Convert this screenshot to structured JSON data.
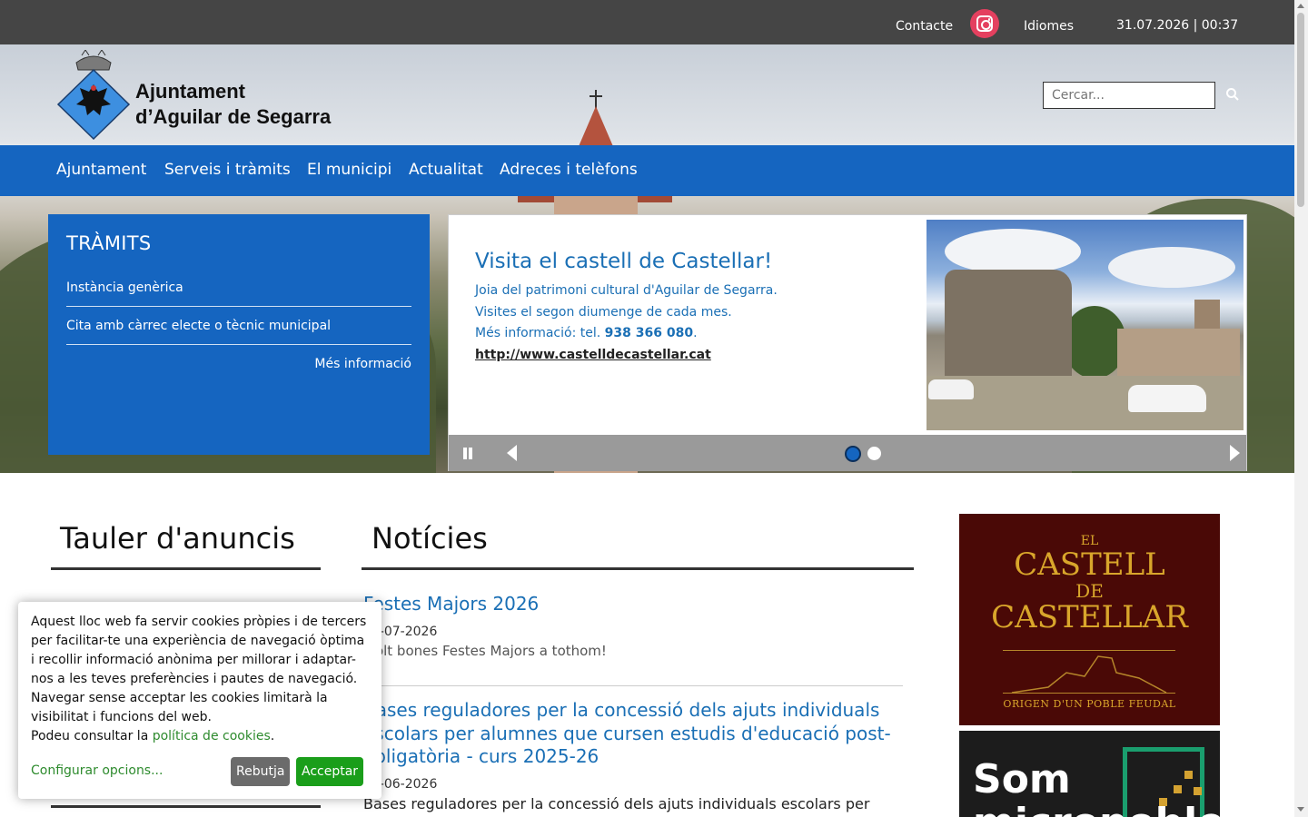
{
  "topbar": {
    "contact_label": "Contacte",
    "instagram_icon": "instagram-icon",
    "languages_label": "Idiomes",
    "datetime": "31.07.2026 | 00:37"
  },
  "header": {
    "logo_icon": "coat-of-arms-icon",
    "site_name_line1": "Ajuntament",
    "site_name_line2": "d’Aguilar de Segarra",
    "search_placeholder": "Cercar...",
    "search_icon": "search-icon"
  },
  "nav": {
    "items": [
      {
        "label": "Ajuntament"
      },
      {
        "label": "Serveis i tràmits"
      },
      {
        "label": "El municipi"
      },
      {
        "label": "Actualitat"
      },
      {
        "label": "Adreces i telèfons"
      }
    ]
  },
  "tramits": {
    "title": "TRÀMITS",
    "items": [
      {
        "label": "Instància genèrica"
      },
      {
        "label": "Cita amb càrrec electe o tècnic municipal"
      }
    ],
    "more_label": "Més informació"
  },
  "slider": {
    "title": "Visita el castell de Castellar!",
    "line1": "Joia del patrimoni cultural d'Aguilar de Segarra.",
    "line2": "Visites el segon diumenge de cada mes.",
    "line3_prefix": "Més informació: tel. ",
    "phone": "938 366 080",
    "line3_suffix": ".",
    "url": "http://www.castelldecastellar.cat",
    "slide_count": 2,
    "active_slide": 1,
    "controls": {
      "pause_icon": "pause-icon",
      "prev_icon": "chevron-left-icon",
      "next_icon": "chevron-right-icon"
    }
  },
  "board": {
    "title": "Tauler d'anuncis"
  },
  "news": {
    "title": "Notícies",
    "items": [
      {
        "title": "Festes Majors 2026",
        "date": "07-07-2026",
        "summary": "Molt bones Festes Majors a tothom!"
      },
      {
        "title": "Bases reguladores per la concessió dels ajuts individuals escolars per alumnes que cursen estudis d'educació post-obligatòria - curs 2025-26",
        "date": "17-06-2026",
        "summary": "Bases reguladores per la concessió dels ajuts individuals escolars per"
      }
    ]
  },
  "banners": {
    "castell": {
      "small": "EL",
      "line1": "CASTELL",
      "line2": "DE",
      "line3": "CASTELLAR",
      "tagline": "ORIGEN D'UN POBLE FEUDAL"
    },
    "micropoble": {
      "text": "Som micropoble"
    }
  },
  "cookies": {
    "text": "Aquest lloc web fa servir cookies pròpies i de tercers per facilitar-te una experiència de navegació òptima i recollir informació anònima per millorar i adaptar-nos a les teves preferències i pautes de navegació. Navegar sense acceptar les cookies limitarà la visibilitat i funcions del web.",
    "policy_prefix": "Podeu consultar la ",
    "policy_link": "política de cookies",
    "policy_suffix": ".",
    "configure_label": "Configurar opcions...",
    "reject_label": "Rebutja",
    "accept_label": "Acceptar"
  },
  "colors": {
    "topbar": "#454545",
    "brand_blue": "#1565c0",
    "link_blue": "#1a6fb5",
    "cookie_green": "#1a9e1a",
    "banner_maroon": "#4a0906"
  }
}
